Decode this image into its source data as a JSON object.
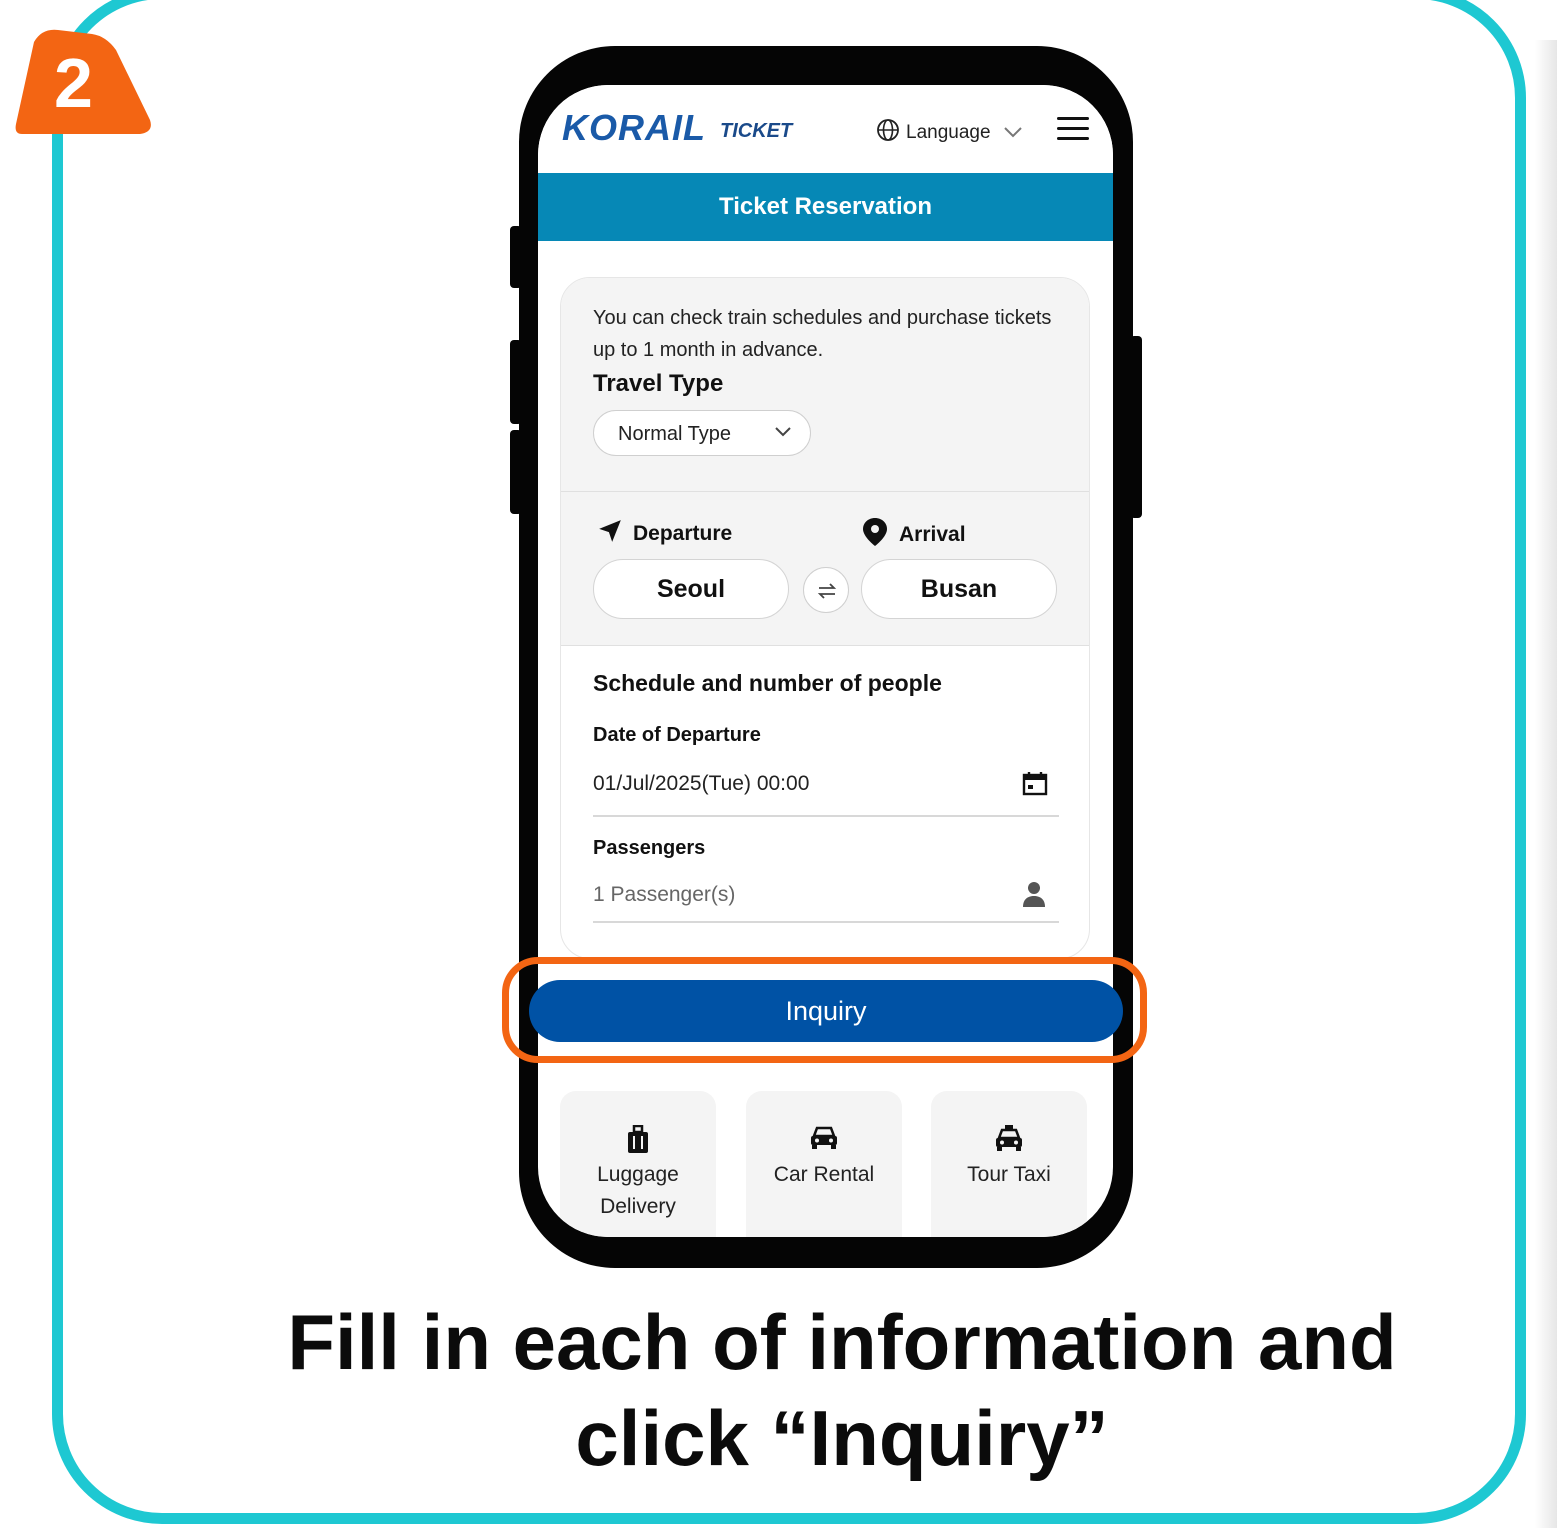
{
  "step": {
    "number": "2"
  },
  "header": {
    "logo": "KORAIL",
    "logo_suffix": "TICKET",
    "language_label": "Language"
  },
  "page": {
    "title": "Ticket Reservation"
  },
  "form": {
    "intro": "You can check train schedules and purchase tickets up to 1 month in advance.",
    "travel_type_label": "Travel Type",
    "travel_type_value": "Normal Type",
    "departure_label": "Departure",
    "departure_value": "Seoul",
    "arrival_label": "Arrival",
    "arrival_value": "Busan",
    "schedule_title": "Schedule and number of people",
    "date_label": "Date of Departure",
    "date_value": "01/Jul/2025(Tue) 00:00",
    "passengers_label": "Passengers",
    "passengers_value": "1 Passenger(s)"
  },
  "inquiry_label": "Inquiry",
  "services": [
    {
      "label": "Luggage Delivery",
      "icon": "luggage-icon"
    },
    {
      "label": "Car Rental",
      "icon": "car-icon"
    },
    {
      "label": "Tour Taxi",
      "icon": "taxi-icon"
    }
  ],
  "caption": {
    "line1": "Fill in each of information and",
    "line2": "click “Inquiry”"
  },
  "colors": {
    "card_border": "#1ec8d2",
    "badge": "#f36513",
    "title_bar": "#0688b6",
    "inquiry_button": "#0052a5",
    "highlight": "#f36513"
  }
}
